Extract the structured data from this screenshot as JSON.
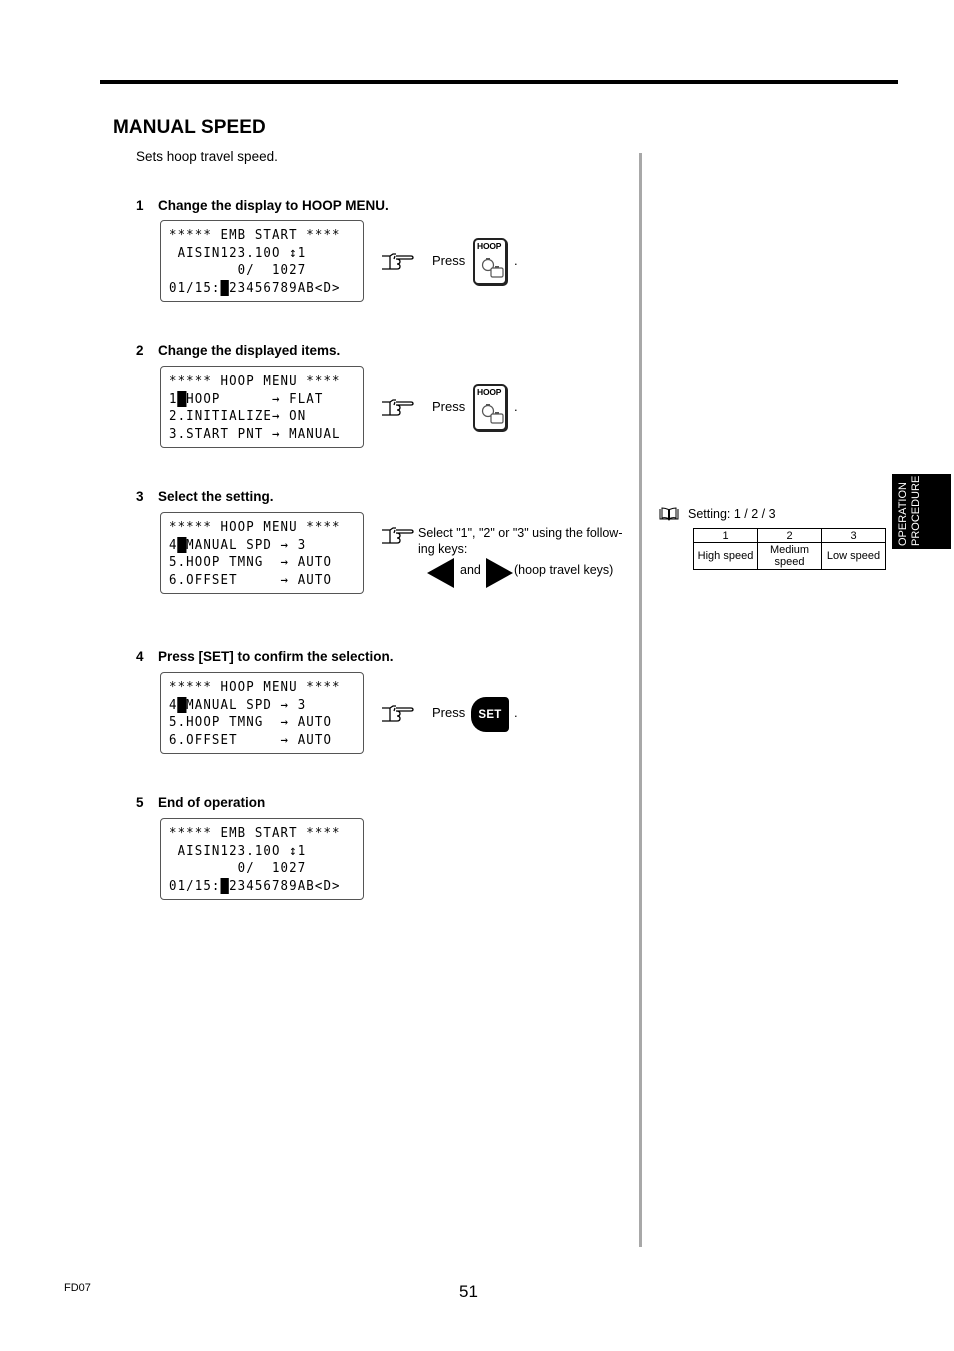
{
  "page": {
    "title": "MANUAL SPEED",
    "intro": "Sets hoop travel speed.",
    "footer_code": "FD07",
    "page_number": "51",
    "side_tab": [
      "OPERATION",
      "PROCEDURE"
    ]
  },
  "steps": [
    {
      "num": "1",
      "heading": "Change the display to HOOP MENU.",
      "lcd": [
        {
          "pre": "***** EMB START ****",
          "cur": "",
          "post": ""
        },
        {
          "pre": " AISIN123.10O ",
          "cur": "",
          "post": "↕1"
        },
        {
          "pre": "        0/  1027",
          "cur": "",
          "post": ""
        },
        {
          "pre": "01/15:",
          "cur": "1",
          "post": "23456789AB<D>"
        }
      ],
      "action": {
        "press_label": "Press",
        "key": "HOOP",
        "suffix": "."
      }
    },
    {
      "num": "2",
      "heading": "Change the displayed items.",
      "lcd": [
        {
          "pre": "***** HOOP MENU ****",
          "cur": "",
          "post": ""
        },
        {
          "pre": "1",
          "cur": ".",
          "post": "HOOP      → FLAT"
        },
        {
          "pre": "2.INITIALIZE→ ON",
          "cur": "",
          "post": ""
        },
        {
          "pre": "3.START PNT → MANUAL",
          "cur": "",
          "post": ""
        }
      ],
      "action": {
        "press_label": "Press",
        "key": "HOOP",
        "suffix": "."
      }
    },
    {
      "num": "3",
      "heading": "Select the setting.",
      "lcd": [
        {
          "pre": "***** HOOP MENU ****",
          "cur": "",
          "post": ""
        },
        {
          "pre": "4",
          "cur": ".",
          "post": "MANUAL SPD → 3"
        },
        {
          "pre": "5.HOOP TMNG  → AUTO",
          "cur": "",
          "post": ""
        },
        {
          "pre": "6.OFFSET     → AUTO",
          "cur": "",
          "post": ""
        }
      ],
      "action": {
        "instruction_line1": "Select \"1\", \"2\" or \"3\" using the follow-",
        "instruction_line2": "ing keys:",
        "and_label": "and",
        "keys_note": "(hoop travel keys)"
      }
    },
    {
      "num": "4",
      "heading": "Press [SET] to confirm the selection.",
      "lcd": [
        {
          "pre": "***** HOOP MENU ****",
          "cur": "",
          "post": ""
        },
        {
          "pre": "4",
          "cur": ".",
          "post": "MANUAL SPD → 3"
        },
        {
          "pre": "5.HOOP TMNG  → AUTO",
          "cur": "",
          "post": ""
        },
        {
          "pre": "6.OFFSET     → AUTO",
          "cur": "",
          "post": ""
        }
      ],
      "action": {
        "press_label": "Press",
        "key": "SET",
        "suffix": "."
      }
    },
    {
      "num": "5",
      "heading": "End of operation",
      "lcd": [
        {
          "pre": "***** EMB START ****",
          "cur": "",
          "post": ""
        },
        {
          "pre": " AISIN123.10O ",
          "cur": "",
          "post": "↕1"
        },
        {
          "pre": "        0/  1027",
          "cur": "",
          "post": ""
        },
        {
          "pre": "01/15:",
          "cur": "1",
          "post": "23456789AB<D>"
        }
      ]
    }
  ],
  "note": {
    "icon": "book-icon",
    "label": "Setting:  1 / 2 / 3",
    "table": {
      "headers": [
        "1",
        "2",
        "3"
      ],
      "values": [
        [
          "High speed"
        ],
        [
          "Medium",
          "speed"
        ],
        [
          "Low speed"
        ]
      ]
    }
  }
}
